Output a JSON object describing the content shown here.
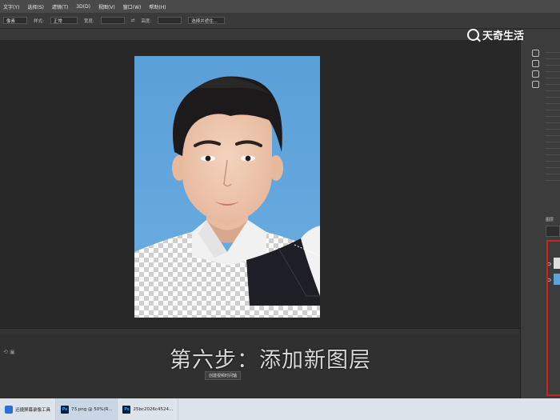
{
  "menu": [
    "文字(Y)",
    "选择(S)",
    "滤镜(T)",
    "3D(D)",
    "视图(V)",
    "窗口(W)",
    "帮助(H)"
  ],
  "options": {
    "item1": "像素",
    "style_label": "样式:",
    "style_value": "正常",
    "width_label": "宽度:",
    "height_label": "高度:",
    "select_mask": "选择并遮住..."
  },
  "caption": "第六步：添加新图层",
  "watermark": "天奇生活",
  "bottom_panel_button": "创建视频时间轴",
  "layers_panel": {
    "title": "图层"
  },
  "taskbar": [
    {
      "label": "迅捷屏幕录像工具",
      "active": false
    },
    {
      "label": "73.png @ 50%(R...",
      "active": true
    },
    {
      "label": "25bc2026c4524...",
      "active": false
    }
  ],
  "colors": {
    "canvas_bg": "#5ea4db",
    "accent_red": "#d21f24"
  }
}
